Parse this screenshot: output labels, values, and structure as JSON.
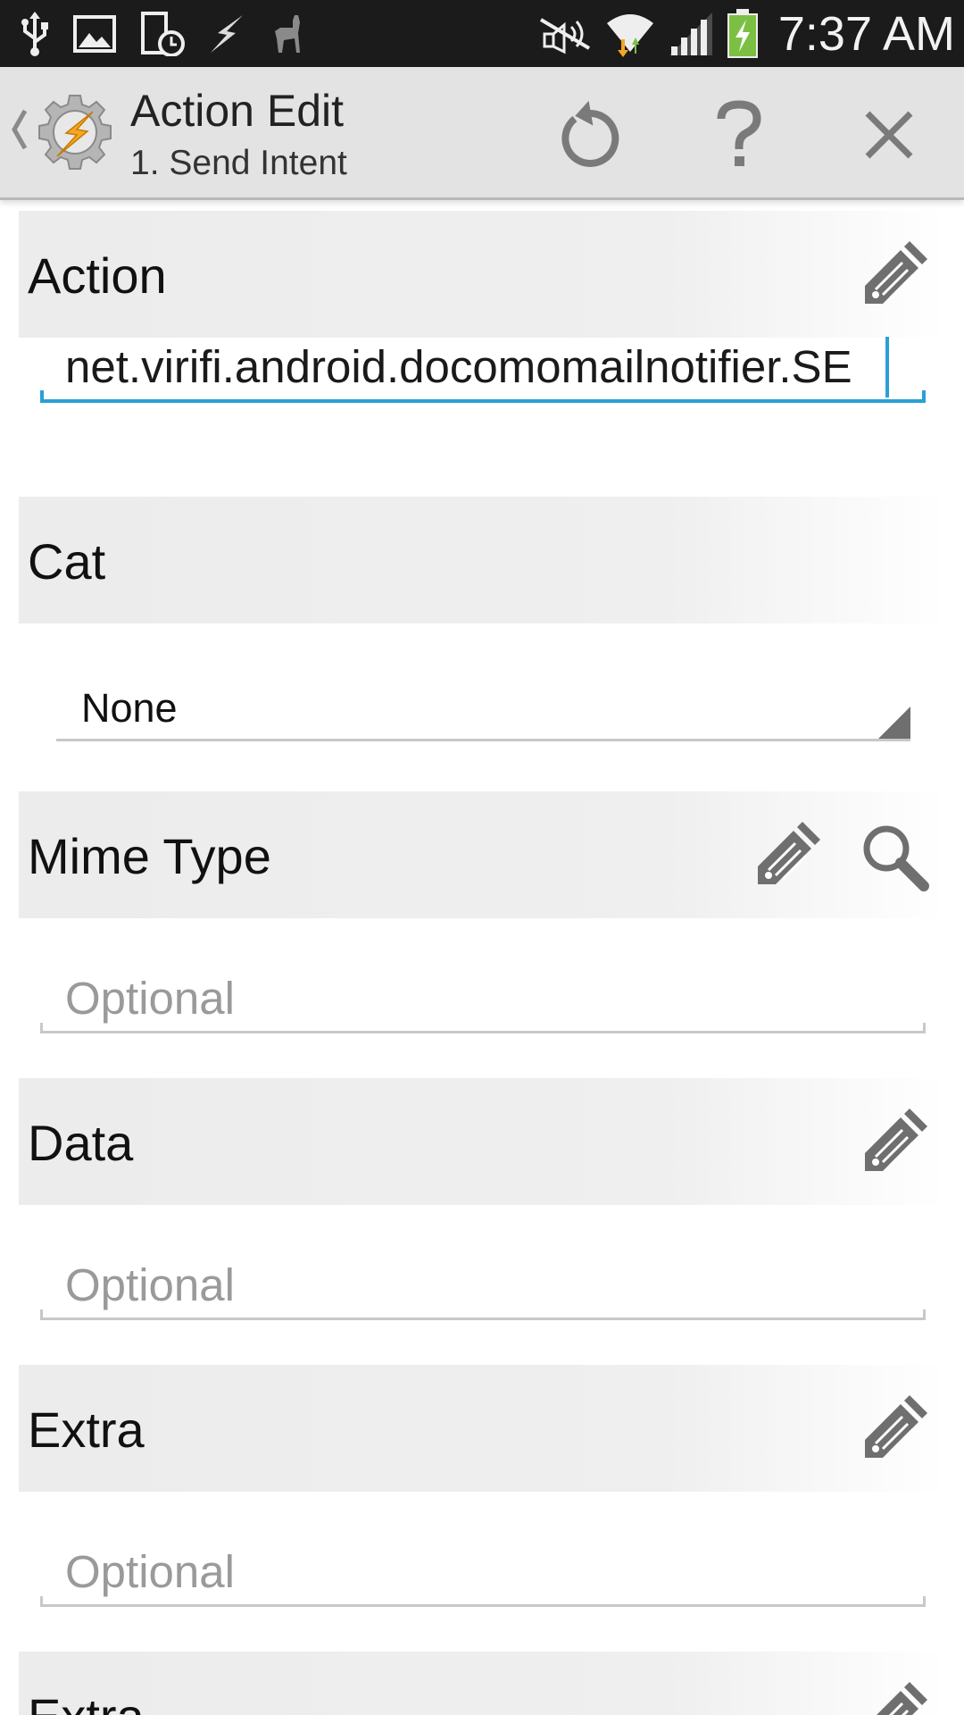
{
  "status_bar": {
    "time": "7:37 AM",
    "icons_left": [
      "usb-icon",
      "image-icon",
      "clock-battery-icon",
      "tasker-bolt-icon",
      "llama-icon"
    ],
    "icons_right": [
      "no-signal-icon",
      "wifi-icon",
      "signal-bars-icon",
      "battery-charging-icon"
    ]
  },
  "action_bar": {
    "title": "Action Edit",
    "subtitle": "1. Send Intent",
    "buttons": [
      "refresh-icon",
      "help-icon",
      "close-icon"
    ]
  },
  "sections": {
    "action": {
      "title": "Action",
      "value": "net.virifi.android.docomomailnotifier.SE"
    },
    "cat": {
      "title": "Cat",
      "selected": "None"
    },
    "mime_type": {
      "title": "Mime Type",
      "placeholder": "Optional",
      "value": ""
    },
    "data": {
      "title": "Data",
      "placeholder": "Optional",
      "value": ""
    },
    "extra1": {
      "title": "Extra",
      "placeholder": "Optional",
      "value": ""
    },
    "extra2": {
      "title": "Extra"
    }
  },
  "colors": {
    "status_bar_bg": "#1b1b1b",
    "action_bar_bg": "#e3e3e3",
    "focus_accent": "#2a9fd6",
    "bolt_orange": "#f5a623"
  }
}
